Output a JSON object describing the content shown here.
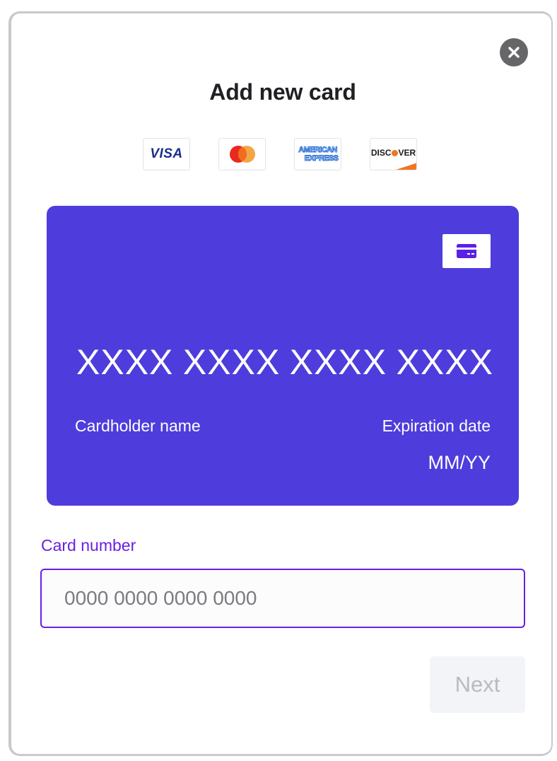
{
  "modal": {
    "title": "Add new card",
    "close_icon": "close-icon"
  },
  "brands": [
    {
      "name": "VISA",
      "icon": "visa-logo"
    },
    {
      "name": "Mastercard",
      "icon": "mastercard-logo"
    },
    {
      "name": "AMERICAN EXPRESS",
      "line1": "AMERICAN",
      "line2": "EXPRESS",
      "icon": "amex-logo"
    },
    {
      "name": "DISCOVER",
      "prefix": "DISC",
      "suffix": "VER",
      "icon": "discover-logo"
    }
  ],
  "card_preview": {
    "number_groups": [
      "XXXX",
      "XXXX",
      "XXXX",
      "XXXX"
    ],
    "holder_label": "Cardholder name",
    "expiration_label": "Expiration date",
    "expiration_value": "MM/YY",
    "chip_icon": "credit-card-icon",
    "colors": {
      "card": "#4e3ddc",
      "icon": "#5b20e6"
    }
  },
  "form": {
    "card_number_label": "Card number",
    "card_number_value": "",
    "card_number_placeholder": "0000 0000 0000 0000",
    "next_label": "Next"
  },
  "colors": {
    "accent": "#6a1fe0",
    "title": "#1f1f24",
    "button_disabled_bg": "#f3f4f7",
    "button_disabled_text": "#b9bac2"
  }
}
